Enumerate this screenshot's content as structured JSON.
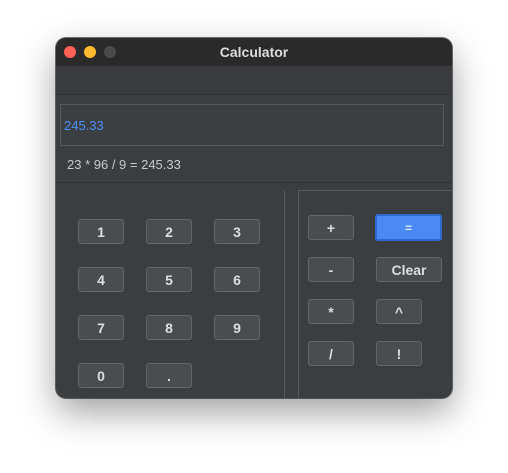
{
  "window": {
    "title": "Calculator"
  },
  "display": {
    "value": "245.33"
  },
  "expression": "23 * 96 / 9 = 245.33",
  "keypad": {
    "digits": [
      "1",
      "2",
      "3",
      "4",
      "5",
      "6",
      "7",
      "8",
      "9",
      "0",
      "."
    ]
  },
  "operators": {
    "plus": "+",
    "equals": "=",
    "minus": "-",
    "clear": "Clear",
    "multiply": "*",
    "power": "^",
    "divide": "/",
    "factorial": "!"
  },
  "colors": {
    "accent": "#4b89f5",
    "display_text": "#4a90ff",
    "window_bg": "#3b3e41",
    "titlebar_bg": "#2a2a2a"
  }
}
